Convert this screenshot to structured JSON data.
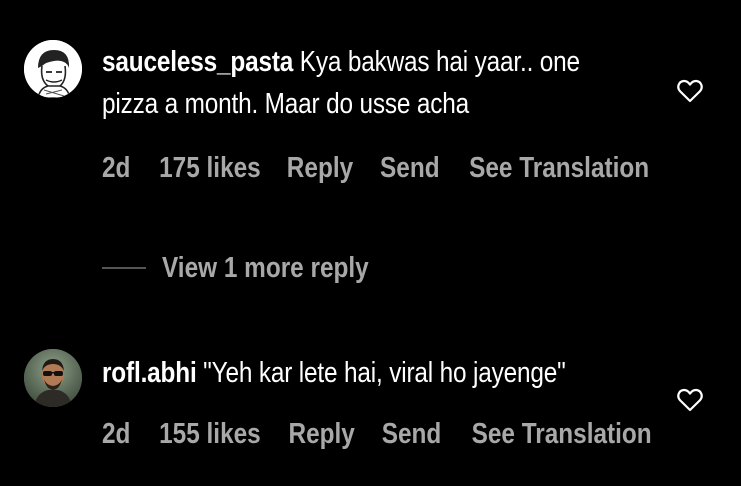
{
  "comments": [
    {
      "username": "sauceless_pasta",
      "text_line1": " Kya bakwas hai yaar.. one",
      "text_line2": "pizza a month. Maar do usse acha",
      "time": "2d",
      "likes": "175 likes",
      "reply": "Reply",
      "send": "Send",
      "translate": "See Translation",
      "avatar_icon": "cartoon-avatar"
    },
    {
      "username": "rofl.abhi",
      "text_line1": " \"Yeh kar lete hai, viral ho jayenge\"",
      "time": "2d",
      "likes": "155 likes",
      "reply": "Reply",
      "send": "Send",
      "translate": "See Translation",
      "avatar_icon": "photo-avatar"
    }
  ],
  "view_more_replies": "View 1 more reply",
  "like_icon": "heart-outline-icon",
  "colors": {
    "background": "#000000",
    "primary_text": "#ffffff",
    "secondary_text": "#a8a8a8"
  }
}
